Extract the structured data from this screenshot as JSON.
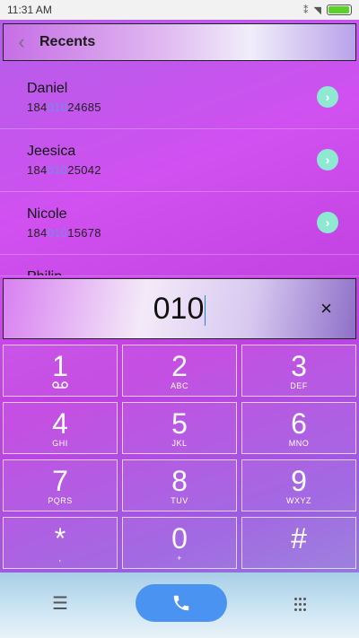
{
  "status": {
    "time": "11:31 AM",
    "icons": [
      "mute-icon",
      "wifi-icon",
      "battery-icon"
    ],
    "battery_percent": 88
  },
  "header": {
    "title": "Recents"
  },
  "recents": [
    {
      "name": "Daniel",
      "number_prefix": "184",
      "number_match": "010",
      "number_suffix": "24685"
    },
    {
      "name": "Jeesica",
      "number_prefix": "184",
      "number_match": "010",
      "number_suffix": "25042"
    },
    {
      "name": "Nicole",
      "number_prefix": "184",
      "number_match": "010",
      "number_suffix": "15678"
    },
    {
      "name": "Philip",
      "number_prefix": "",
      "number_match": "",
      "number_suffix": ""
    }
  ],
  "input": {
    "value": "010",
    "clear_icon": "×"
  },
  "keypad": [
    {
      "digit": "1",
      "letters": ""
    },
    {
      "digit": "2",
      "letters": "ABC"
    },
    {
      "digit": "3",
      "letters": "DEF"
    },
    {
      "digit": "4",
      "letters": "GHI"
    },
    {
      "digit": "5",
      "letters": "JKL"
    },
    {
      "digit": "6",
      "letters": "MNO"
    },
    {
      "digit": "7",
      "letters": "PQRS"
    },
    {
      "digit": "8",
      "letters": "TUV"
    },
    {
      "digit": "9",
      "letters": "WXYZ"
    },
    {
      "digit": "*",
      "letters": ","
    },
    {
      "digit": "0",
      "letters": "+"
    },
    {
      "digit": "#",
      "letters": ""
    }
  ],
  "colors": {
    "accent": "#4a93f0",
    "match_highlight": "#6d8ee8",
    "go_button": "#8ee8d2"
  }
}
